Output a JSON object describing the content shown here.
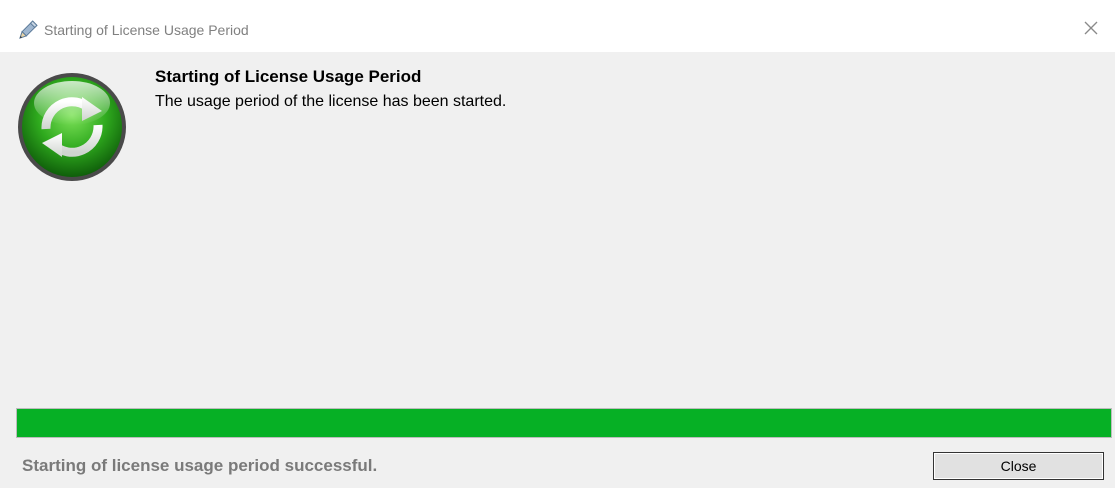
{
  "window": {
    "title": "Starting of License Usage Period",
    "title_icon": "pencil-icon",
    "close_icon": "close-icon"
  },
  "content": {
    "icon": "refresh-circle-icon",
    "heading": "Starting of License Usage Period",
    "message": "The usage period of the license has been started."
  },
  "progress": {
    "value_percent": 100,
    "color": "#06b025"
  },
  "footer": {
    "status_text": "Starting of license usage period successful.",
    "close_label": "Close"
  },
  "colors": {
    "client_background": "#f0f0f0",
    "accent_green": "#06b025"
  }
}
